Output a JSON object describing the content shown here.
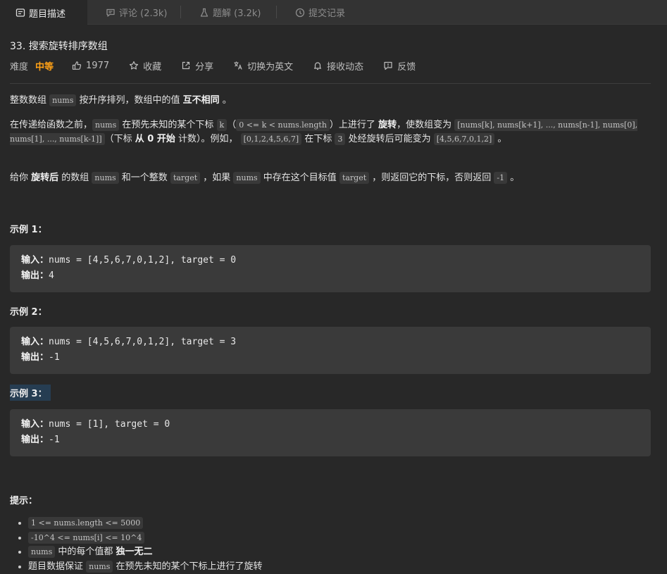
{
  "tabs": [
    {
      "label": "题目描述",
      "icon": "description-icon"
    },
    {
      "label": "评论 (2.3k)",
      "icon": "comment-icon"
    },
    {
      "label": "题解 (3.2k)",
      "icon": "flask-icon"
    },
    {
      "label": "提交记录",
      "icon": "history-icon"
    }
  ],
  "problem": {
    "title": "33. 搜索旋转排序数组",
    "difficulty_label": "难度",
    "difficulty": "中等",
    "likes": "1977",
    "favorite": "收藏",
    "share": "分享",
    "translate": "切换为英文",
    "subscribe": "接收动态",
    "feedback": "反馈"
  },
  "description": {
    "p1": {
      "a": "整数数组 ",
      "code1": "nums",
      "b": " 按升序排列，数组中的值 ",
      "bold": "互不相同",
      "c": " 。"
    },
    "p2": {
      "a": "在传递给函数之前，",
      "code1": "nums",
      "b": " 在预先未知的某个下标 ",
      "code2": "k",
      "c": "（",
      "code3": "0 <= k < nums.length",
      "d": "）上进行了 ",
      "bold1": "旋转",
      "e": "，使数组变为 ",
      "code4": "[nums[k], nums[k+1], ..., nums[n-1], nums[0], nums[1], ..., nums[k-1]]",
      "f": "（下标 ",
      "bold2": "从 0 开始",
      "g": " 计数）。例如， ",
      "code5": "[0,1,2,4,5,6,7]",
      "h": " 在下标 ",
      "code6": "3",
      "i": " 处经旋转后可能变为 ",
      "code7": "[4,5,6,7,0,1,2]",
      "j": " 。"
    },
    "p3": {
      "a": "给你 ",
      "bold": "旋转后",
      "b": " 的数组 ",
      "code1": "nums",
      "c": " 和一个整数 ",
      "code2": "target",
      "d": " ，如果 ",
      "code3": "nums",
      "e": " 中存在这个目标值 ",
      "code4": "target",
      "f": " ，则返回它的下标，否则返回 ",
      "code5": "-1",
      "g": " 。"
    }
  },
  "examples": [
    {
      "title": "示例 1：",
      "input_label": "输入：",
      "input": "nums = [4,5,6,7,0,1,2], target = 0",
      "output_label": "输出：",
      "output": "4"
    },
    {
      "title": "示例 2：",
      "input_label": "输入：",
      "input": "nums = [4,5,6,7,0,1,2], target = 3",
      "output_label": "输出：",
      "output": "-1"
    },
    {
      "title": "示例 3：",
      "input_label": "输入：",
      "input": "nums = [1], target = 0",
      "output_label": "输出：",
      "output": "-1"
    }
  ],
  "hints_title": "提示：",
  "hints": [
    {
      "code": "1 <= nums.length <= 5000"
    },
    {
      "code": "-10^4 <= nums[i] <= 10^4"
    },
    {
      "code": "nums",
      "text": " 中的每个值都 ",
      "bold": "独一无二"
    },
    {
      "text": "题目数据保证 ",
      "code": "nums",
      "text2": " 在预先未知的某个下标上进行了旋转"
    }
  ],
  "colors": {
    "background": "#282828",
    "difficulty": "#ffa116",
    "code_bg": "#393939",
    "example_bg": "#3a3a3a"
  }
}
